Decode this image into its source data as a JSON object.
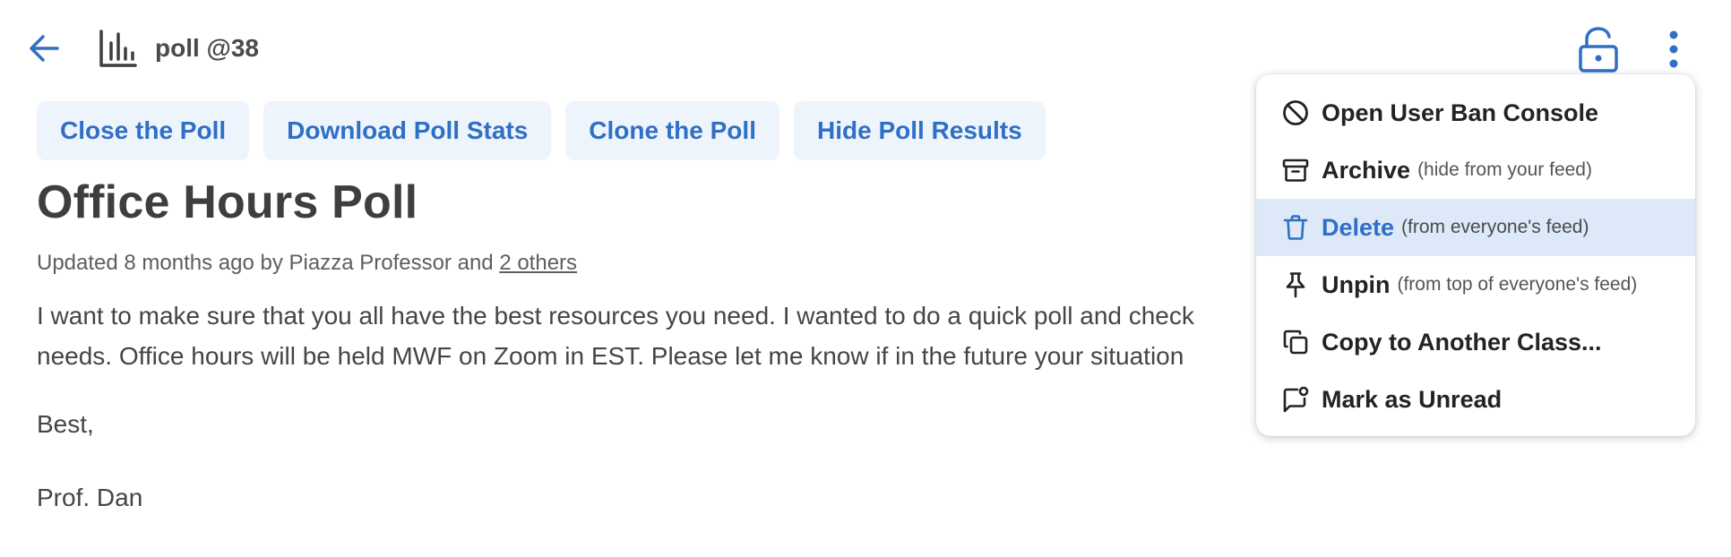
{
  "header": {
    "post_id": "poll @38"
  },
  "actions": [
    {
      "label": "Close the Poll"
    },
    {
      "label": "Download Poll Stats"
    },
    {
      "label": "Clone the Poll"
    },
    {
      "label": "Hide Poll Results"
    }
  ],
  "post": {
    "title": "Office Hours Poll",
    "meta_prefix": "Updated 8 months ago by Piazza Professor and",
    "meta_link": "2 others",
    "body_lines": [
      "I want to make sure that you all have the best resources you need. I wanted to do a quick poll and check",
      "needs. Office hours will be held MWF on Zoom in EST. Please let me know if in the future your situation"
    ],
    "signoff_1": "Best,",
    "signoff_2": "Prof. Dan"
  },
  "menu": {
    "items": [
      {
        "label": "Open User Ban Console",
        "hint": "",
        "icon": "ban-icon"
      },
      {
        "label": "Archive",
        "hint": "(hide from your feed)",
        "icon": "archive-icon"
      },
      {
        "label": "Delete",
        "hint": "(from everyone's feed)",
        "icon": "trash-icon",
        "highlighted": true
      },
      {
        "label": "Unpin",
        "hint": "(from top of everyone's feed)",
        "icon": "pin-icon"
      },
      {
        "label": "Copy to Another Class...",
        "hint": "",
        "icon": "copy-icon"
      },
      {
        "label": "Mark as Unread",
        "hint": "",
        "icon": "mark-unread-icon"
      }
    ]
  },
  "colors": {
    "accent": "#2f6fc6",
    "button_bg": "#eef4fc",
    "highlight_bg": "#dde9f8",
    "text": "#3d3d3d"
  }
}
